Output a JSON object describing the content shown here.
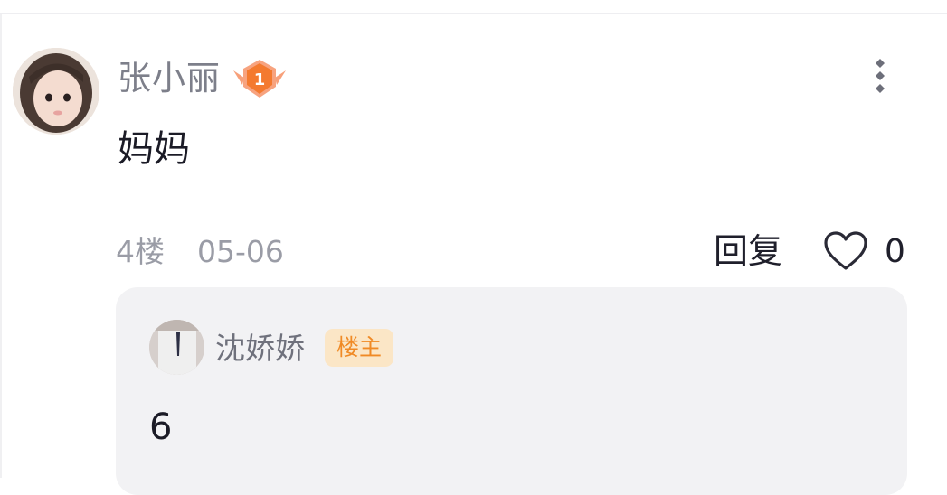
{
  "comment": {
    "author": "张小丽",
    "level": "1",
    "text": "妈妈",
    "floor": "4楼",
    "date": "05-06",
    "reply_label": "回复",
    "like_count": "0"
  },
  "reply": {
    "author": "沈娇娇",
    "tag": "楼主",
    "text": "6"
  },
  "icons": {
    "more": "more-vertical-icon",
    "like": "heart-outline-icon",
    "level": "level-badge-icon"
  },
  "colors": {
    "accent_orange": "#f08a25",
    "tag_bg": "#fbe6c6",
    "reply_bg": "#f2f2f4",
    "muted_text": "#9a9ca6"
  }
}
